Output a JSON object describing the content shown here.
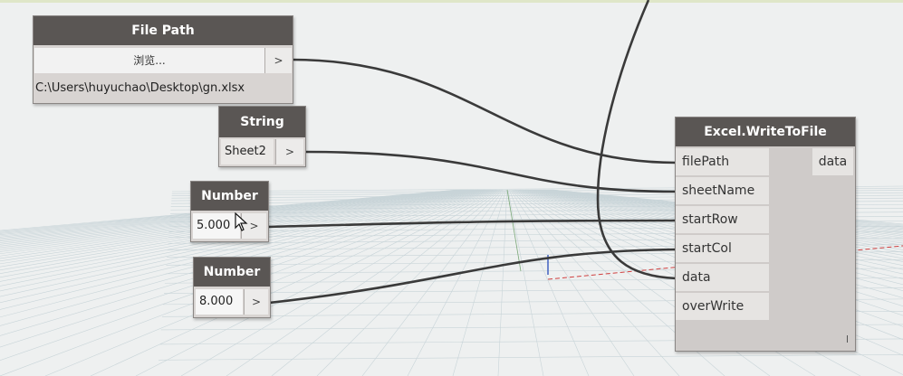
{
  "nodes": {
    "file_path": {
      "title": "File Path",
      "browse_label": "浏览...",
      "output_arrow": ">",
      "value": "C:\\Users\\huyuchao\\Desktop\\gn.xlsx"
    },
    "string": {
      "title": "String",
      "value": "Sheet2",
      "output_arrow": ">"
    },
    "number_1": {
      "title": "Number",
      "value": "5.000",
      "output_arrow": ">"
    },
    "number_2": {
      "title": "Number",
      "value": "8.000",
      "output_arrow": ">"
    },
    "excel_write": {
      "title": "Excel.WriteToFile",
      "inputs": [
        "filePath",
        "sheetName",
        "startRow",
        "startCol",
        "data",
        "overWrite"
      ],
      "output": "data"
    }
  },
  "colors": {
    "node_header": "#5a5654",
    "node_body": "#d8d4d2",
    "wire": "#3a3a3a",
    "canvas": "#eef0f0"
  },
  "icons": [
    "mouse-cursor-icon"
  ]
}
